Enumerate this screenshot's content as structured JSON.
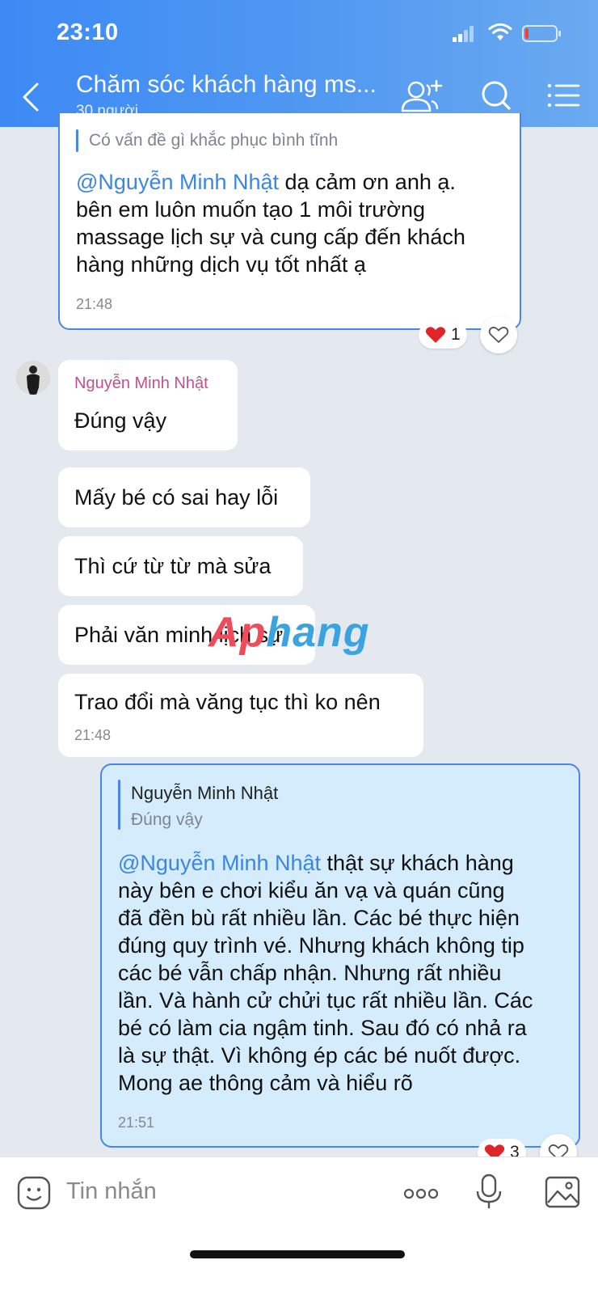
{
  "status": {
    "time": "23:10"
  },
  "header": {
    "title": "Chăm sóc khách hàng ms...",
    "subtitle": "30 người",
    "icons": [
      "back-icon",
      "add-member-icon",
      "search-icon",
      "menu-icon"
    ]
  },
  "messages": {
    "m1": {
      "quote_text": "Có vấn đề gì khắc phục bình tĩnh",
      "mention": "@Nguyễn Minh Nhật",
      "line1_rest": " dạ cảm ơn anh ạ.",
      "line2": "bên em luôn muốn tạo 1 môi trường",
      "line3": "massage lịch sự và cung cấp đến khách",
      "line4": "hàng những dịch vụ tốt nhất ạ",
      "time": "21:48",
      "reaction_count": "1"
    },
    "m2": {
      "sender": "Nguyễn Minh Nhật",
      "text": "Đúng vậy"
    },
    "m3": {
      "text": "Mấy bé có sai hay lỗi"
    },
    "m4": {
      "text": "Thì cứ từ từ mà sửa"
    },
    "m5": {
      "text": "Phải văn minh lịch sự"
    },
    "m6": {
      "text": "Trao đổi mà văng tục thì ko nên",
      "time": "21:48"
    },
    "m7": {
      "quote_name": "Nguyễn Minh Nhật",
      "quote_text": "Đúng vậy",
      "mention": "@Nguyễn Minh Nhật",
      "line1_rest": " thật sự khách hàng",
      "line2": "này bên e chơi kiểu ăn vạ và quán cũng",
      "line3": "đã đền bù rất nhiều lần. Các bé thực hiện",
      "line4": "đúng quy trình vé. Nhưng khách không tip",
      "line5": "các bé vẫn chấp nhận. Nhưng rất nhiều",
      "line6": "lần. Và hành cử chửi tục rất nhiều lần. Các",
      "line7": "bé có làm cia ngậm tinh. Sau đó có nhả ra",
      "line8": "là sự thật. Vì không ép các bé nuốt được.",
      "line9": "Mong ae thông cảm và hiểu rõ",
      "time": "21:51",
      "reaction_count": "3"
    }
  },
  "watermark": "Aphang",
  "composer": {
    "placeholder": "Tin nhắn"
  },
  "colors": {
    "header": "#3d8af5",
    "accent": "#4a86e8",
    "mine_bubble": "#d5ecfd",
    "heart": "#e0242a"
  }
}
